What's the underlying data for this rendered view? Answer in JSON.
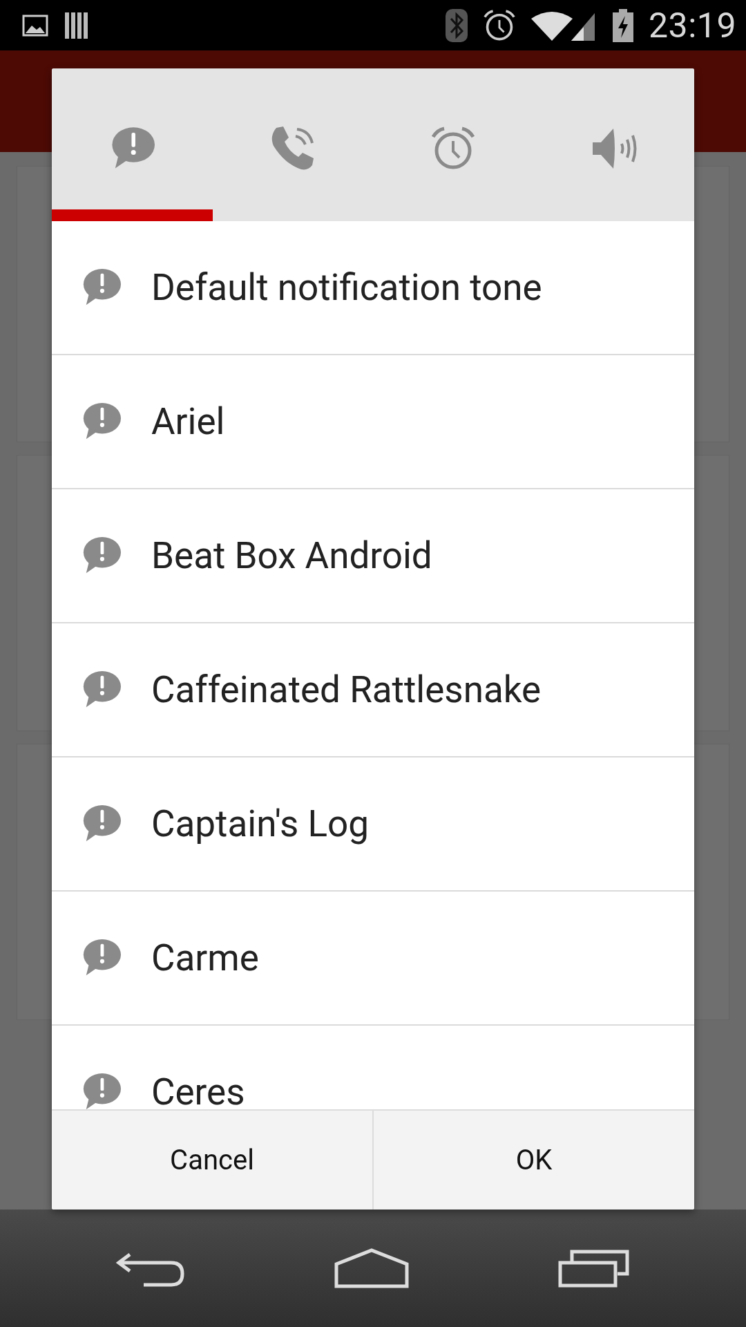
{
  "status_bar": {
    "time": "23:19"
  },
  "dialog": {
    "tabs": [
      {
        "kind": "notification",
        "selected": true
      },
      {
        "kind": "ringtone",
        "selected": false
      },
      {
        "kind": "alarm",
        "selected": false
      },
      {
        "kind": "media",
        "selected": false
      }
    ],
    "tones": [
      {
        "name": "Default notification tone"
      },
      {
        "name": "Ariel"
      },
      {
        "name": "Beat Box Android"
      },
      {
        "name": "Caffeinated Rattlesnake"
      },
      {
        "name": "Captain's Log"
      },
      {
        "name": "Carme"
      },
      {
        "name": "Ceres"
      }
    ],
    "buttons": [
      {
        "label": "Cancel"
      },
      {
        "label": "OK"
      }
    ]
  }
}
